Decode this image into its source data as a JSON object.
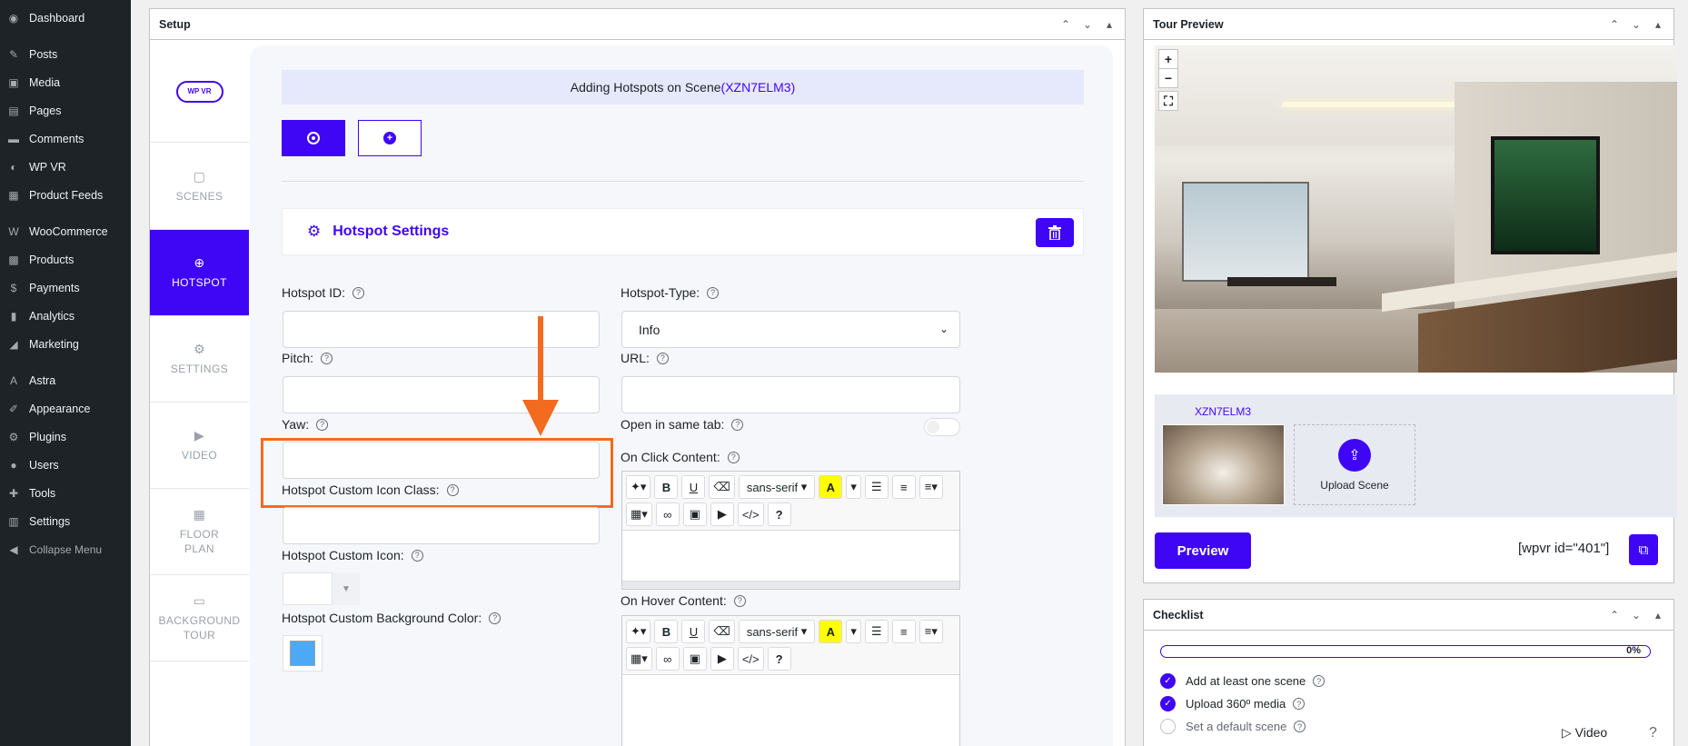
{
  "admin_menu": [
    {
      "label": "Dashboard",
      "icon": "dashboard-icon",
      "glyph": "◉"
    },
    {
      "label": "Posts",
      "icon": "pin-icon",
      "glyph": "✎"
    },
    {
      "label": "Media",
      "icon": "media-icon",
      "glyph": "▣"
    },
    {
      "label": "Pages",
      "icon": "pages-icon",
      "glyph": "▤"
    },
    {
      "label": "Comments",
      "icon": "comments-icon",
      "glyph": "▬"
    },
    {
      "label": "WP VR",
      "icon": "vr-icon",
      "glyph": "◐"
    },
    {
      "label": "Product Feeds",
      "icon": "feed-icon",
      "glyph": "▦"
    },
    {
      "label": "WooCommerce",
      "icon": "woo-icon",
      "glyph": "W"
    },
    {
      "label": "Products",
      "icon": "products-icon",
      "glyph": "▩"
    },
    {
      "label": "Payments",
      "icon": "payments-icon",
      "glyph": "$"
    },
    {
      "label": "Analytics",
      "icon": "analytics-icon",
      "glyph": "▮"
    },
    {
      "label": "Marketing",
      "icon": "marketing-icon",
      "glyph": "◢"
    },
    {
      "label": "Astra",
      "icon": "astra-icon",
      "glyph": "A"
    },
    {
      "label": "Appearance",
      "icon": "appearance-icon",
      "glyph": "✐"
    },
    {
      "label": "Plugins",
      "icon": "plugins-icon",
      "glyph": "⚙"
    },
    {
      "label": "Users",
      "icon": "users-icon",
      "glyph": "●"
    },
    {
      "label": "Tools",
      "icon": "tools-icon",
      "glyph": "✚"
    },
    {
      "label": "Settings",
      "icon": "settings-icon",
      "glyph": "▥"
    },
    {
      "label": "Collapse Menu",
      "icon": "collapse-icon",
      "glyph": "◀"
    }
  ],
  "setup": {
    "title": "Setup",
    "logo_text": "WP VR",
    "tabs": [
      {
        "label": "SCENES",
        "icon": "image-icon",
        "glyph": "▢"
      },
      {
        "label": "HOTSPOT",
        "icon": "hotspot-icon",
        "glyph": "⊕"
      },
      {
        "label": "SETTINGS",
        "icon": "gear-icon",
        "glyph": "⚙"
      },
      {
        "label": "VIDEO",
        "icon": "video-icon",
        "glyph": "▶"
      },
      {
        "label": "FLOOR PLAN",
        "icon": "map-icon",
        "glyph": "▦"
      },
      {
        "label": "BACKGROUND TOUR",
        "icon": "background-icon",
        "glyph": "▭"
      }
    ],
    "banner_prefix": "Adding Hotspots on Scene",
    "scene_id": "(XZN7ELM3)",
    "settings_title": "Hotspot Settings",
    "fields": {
      "hotspot_id": "Hotspot ID:",
      "hotspot_type": "Hotspot-Type:",
      "hotspot_type_value": "Info",
      "pitch": "Pitch:",
      "url": "URL:",
      "yaw": "Yaw:",
      "open_same_tab": "Open in same tab:",
      "custom_icon_class": "Hotspot Custom Icon Class:",
      "on_click": "On Click Content:",
      "custom_icon": "Hotspot Custom Icon:",
      "custom_bg": "Hotspot Custom Background Color:",
      "on_hover": "On Hover Content:"
    },
    "editor": {
      "font": "sans-serif",
      "bold": "B",
      "underline": "U",
      "highlight": "A",
      "code": "</>",
      "help": "?"
    },
    "colors": {
      "accent": "#3f05f5",
      "highlight_border": "#f36b1f",
      "bg_swatch": "#4ea9f5"
    }
  },
  "tour": {
    "title": "Tour Preview",
    "zoom_in": "+",
    "zoom_out": "−",
    "scene_name": "XZN7ELM3",
    "upload_label": "Upload Scene",
    "preview_label": "Preview",
    "shortcode": "[wpvr id=\"401\"]"
  },
  "checklist": {
    "title": "Checklist",
    "progress_percent": 0,
    "progress_label": "0%",
    "items": [
      {
        "label": "Add at least one scene",
        "done": true
      },
      {
        "label": "Upload 360º media",
        "done": true
      },
      {
        "label": "Set a default scene",
        "done": false
      }
    ],
    "video_label": "▷ Video",
    "help_label": "?"
  }
}
